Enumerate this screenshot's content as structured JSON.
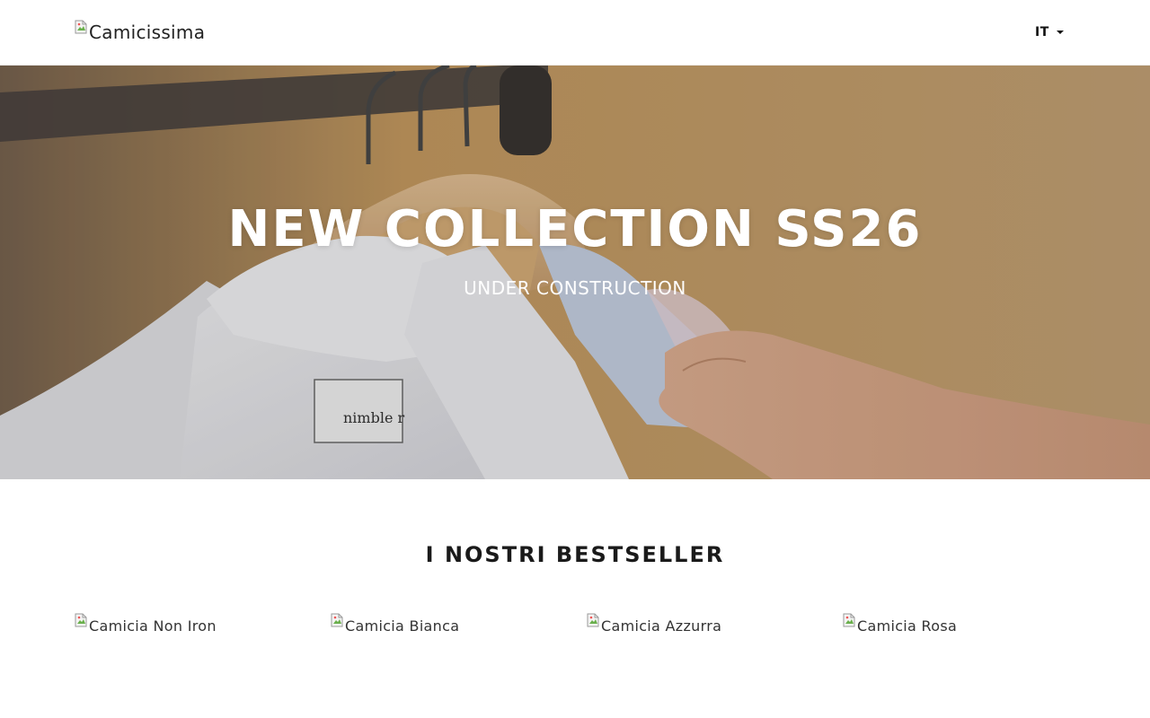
{
  "header": {
    "logo_alt": "Camicissima",
    "language": "IT"
  },
  "hero": {
    "title": "NEW COLLECTION SS26",
    "subtitle": "UNDER CONSTRUCTION",
    "label_text": "nimble r"
  },
  "bestsellers": {
    "title": "I NOSTRI BESTSELLER",
    "products": [
      {
        "alt": "Camicia Non Iron"
      },
      {
        "alt": "Camicia Bianca"
      },
      {
        "alt": "Camicia Azzurra"
      },
      {
        "alt": "Camicia Rosa"
      }
    ]
  },
  "colors": {
    "hero_background": "#c29a63",
    "text_dark": "#1a1a1a",
    "white": "#ffffff"
  }
}
